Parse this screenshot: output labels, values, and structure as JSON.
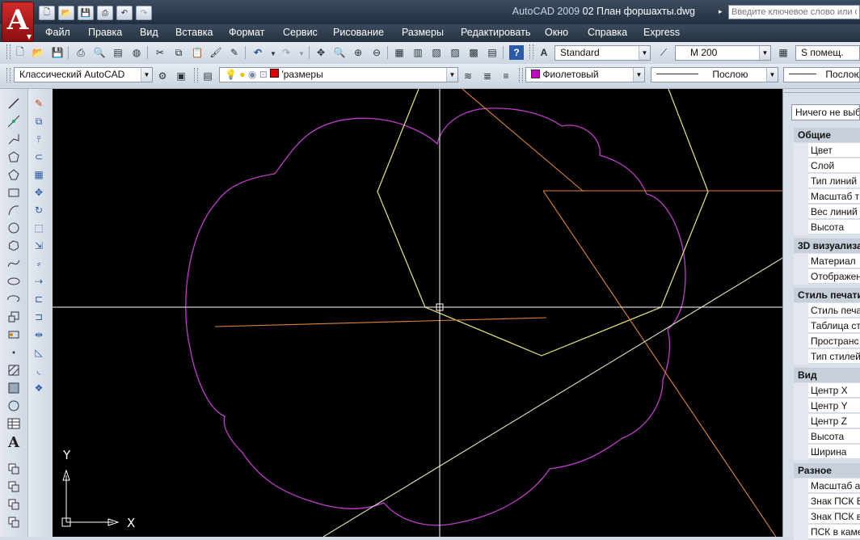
{
  "app": {
    "logo_letter": "A",
    "title_app": "AutoCAD 2009",
    "title_file": "02 План форшахты.dwg",
    "search_placeholder": "Введите ключевое слово или фр"
  },
  "menu": [
    "Файл",
    "Правка",
    "Вид",
    "Вставка",
    "Формат",
    "Сервис",
    "Рисование",
    "Размеры",
    "Редактировать",
    "Окно",
    "Справка",
    "Express"
  ],
  "toolbar2": {
    "text_style": "Standard",
    "dim_style": "М 200",
    "table_style": "S помещ."
  },
  "toolbar3": {
    "workspace": "Классический AutoCAD",
    "layer": "'размеры",
    "color": "Фиолетовый",
    "color_hex": "#c800c8",
    "linetype": "Послою",
    "lineweight": "Послою"
  },
  "ucs": {
    "x_label": "X",
    "y_label": "Y"
  },
  "properties": {
    "selection": "Ничего не выб",
    "categories": [
      {
        "name": "Общие",
        "rows": [
          "Цвет",
          "Слой",
          "Тип линий",
          "Масштаб т",
          "Вес линий",
          "Высота"
        ]
      },
      {
        "name": "3D визуализа",
        "rows": [
          "Материал",
          "Отображен"
        ]
      },
      {
        "name": "Стиль печати",
        "rows": [
          "Стиль печа",
          "Таблица ст",
          "Пространс",
          "Тип стилей"
        ]
      },
      {
        "name": "Вид",
        "rows": [
          "Центр X",
          "Центр Y",
          "Центр Z",
          "Высота",
          "Ширина"
        ]
      },
      {
        "name": "Разное",
        "rows": [
          "Масштаб а",
          "Знак ПСК В",
          "Знак ПСК в",
          "ПСК в камер"
        ]
      }
    ]
  },
  "colors": {
    "cloud": "#c03ccc",
    "hexagon": "#e6e67a",
    "orange": "#e0853a",
    "crosshair": "#ffffff",
    "construction": "#dde8b8"
  }
}
